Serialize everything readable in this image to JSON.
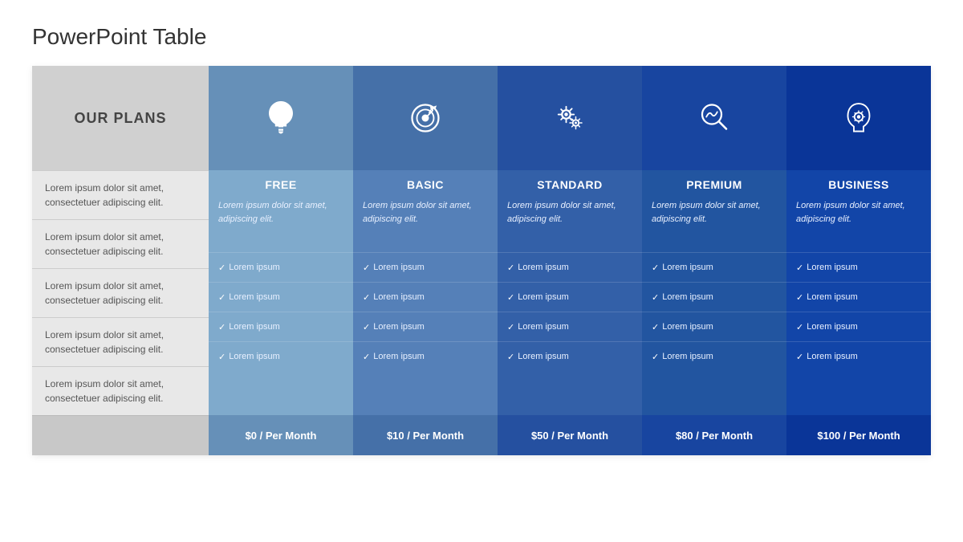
{
  "page": {
    "title": "PowerPoint Table"
  },
  "labels_col": {
    "header": "OUR PLANS",
    "rows": [
      "Lorem ipsum dolor sit amet, consectetuer adipiscing elit.",
      "Lorem ipsum dolor sit amet, consectetuer adipiscing elit.",
      "Lorem ipsum dolor sit amet, consectetuer adipiscing elit.",
      "Lorem ipsum dolor sit amet, consectetuer adipiscing elit.",
      "Lorem ipsum dolor sit amet, consectetuer adipiscing elit."
    ]
  },
  "plans": [
    {
      "id": "free",
      "css_class": "plan-free",
      "name": "FREE",
      "description": "Lorem ipsum dolor sit amet, adipiscing elit.",
      "features": [
        "Lorem ipsum",
        "Lorem ipsum",
        "Lorem ipsum",
        "Lorem ipsum"
      ],
      "price": "$0 / Per Month",
      "icon": "bulb"
    },
    {
      "id": "basic",
      "css_class": "plan-basic",
      "name": "BASIC",
      "description": "Lorem ipsum dolor sit amet, adipiscing elit.",
      "features": [
        "Lorem ipsum",
        "Lorem ipsum",
        "Lorem ipsum",
        "Lorem ipsum"
      ],
      "price": "$10 / Per Month",
      "icon": "target"
    },
    {
      "id": "standard",
      "css_class": "plan-standard",
      "name": "STANDARD",
      "description": "Lorem ipsum dolor sit amet, adipiscing elit.",
      "features": [
        "Lorem ipsum",
        "Lorem ipsum",
        "Lorem ipsum",
        "Lorem ipsum"
      ],
      "price": "$50 / Per Month",
      "icon": "gears"
    },
    {
      "id": "premium",
      "css_class": "plan-premium",
      "name": "PREMIUM",
      "description": "Lorem ipsum dolor sit amet, adipiscing elit.",
      "features": [
        "Lorem ipsum",
        "Lorem ipsum",
        "Lorem ipsum",
        "Lorem ipsum"
      ],
      "price": "$80 / Per Month",
      "icon": "analytics"
    },
    {
      "id": "business",
      "css_class": "plan-business",
      "name": "BUSINESS",
      "description": "Lorem ipsum dolor sit amet, adipiscing elit.",
      "features": [
        "Lorem ipsum",
        "Lorem ipsum",
        "Lorem ipsum",
        "Lorem ipsum"
      ],
      "price": "$100 / Per Month",
      "icon": "brain"
    }
  ]
}
